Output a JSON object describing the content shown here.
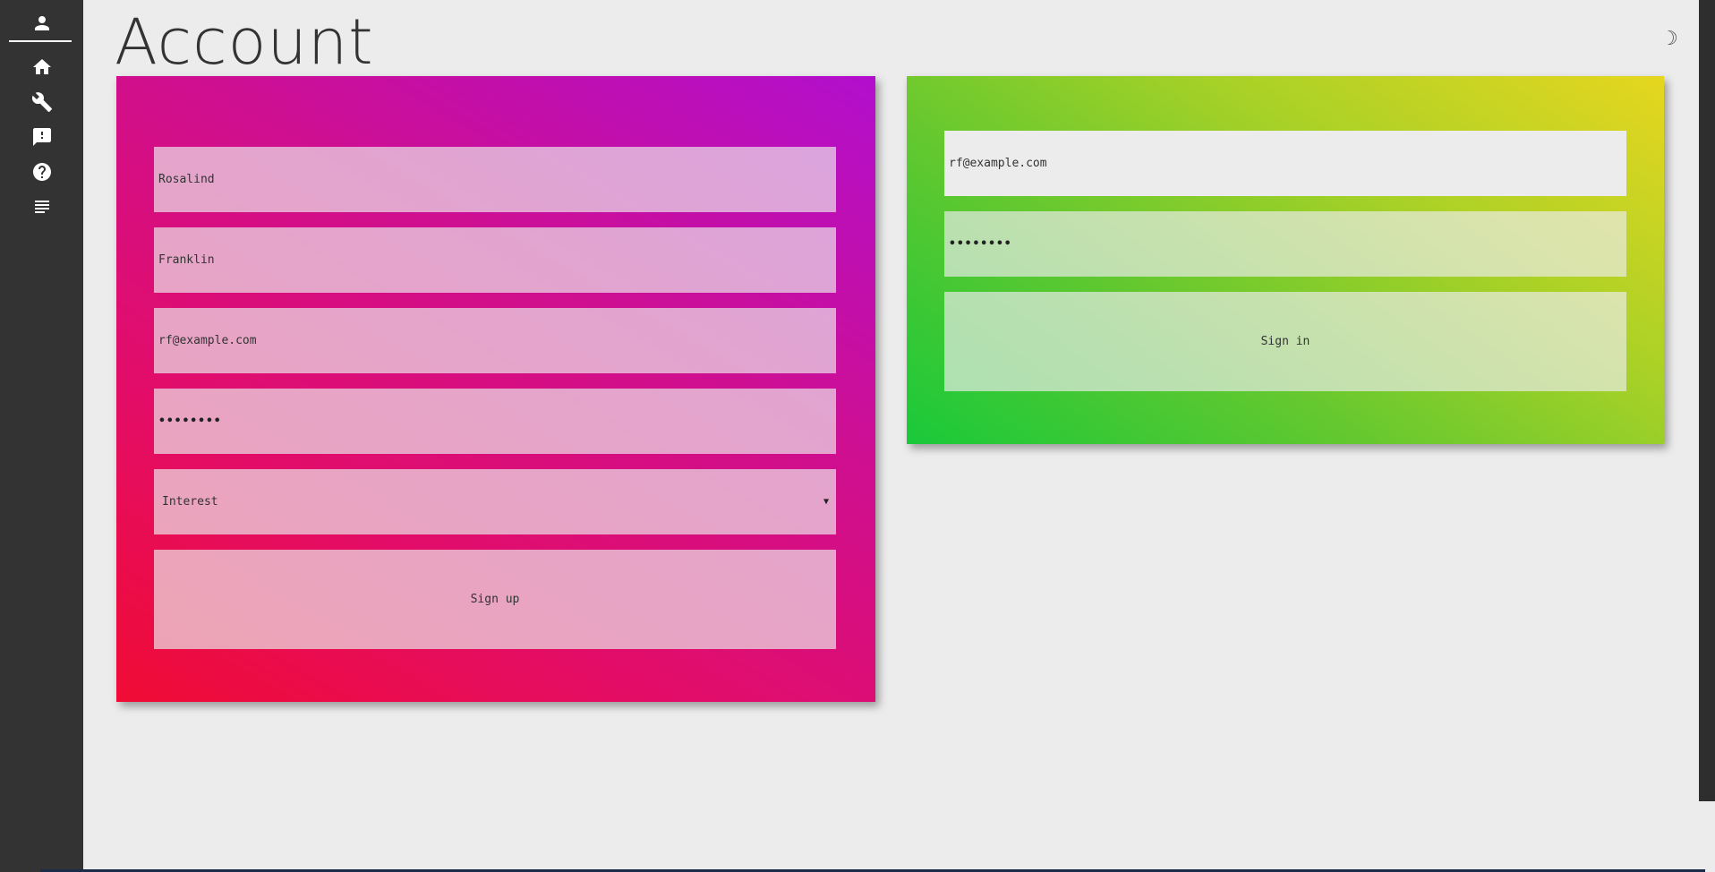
{
  "sidebar": {
    "items": [
      {
        "icon": "person-icon",
        "name": "account"
      },
      {
        "icon": "home-icon",
        "name": "home"
      },
      {
        "icon": "wrench-icon",
        "name": "tools"
      },
      {
        "icon": "feedback-icon",
        "name": "feedback"
      },
      {
        "icon": "help-icon",
        "name": "help"
      },
      {
        "icon": "notes-icon",
        "name": "notes"
      }
    ]
  },
  "header": {
    "title": "Account",
    "theme_toggle_icon": "moon-icon",
    "theme_toggle_glyph": "☽"
  },
  "signup": {
    "gradient": [
      "#f00c34",
      "#b20fcd"
    ],
    "first_name": "Rosalind",
    "last_name": "Franklin",
    "email": "rf@example.com",
    "password": "••••••••",
    "interest": "Interest",
    "caret": "▼",
    "button": "Sign up"
  },
  "signin": {
    "gradient": [
      "#19c93a",
      "#e6d61f"
    ],
    "email": "rf@example.com",
    "password": "••••••••",
    "button": "Sign in"
  }
}
